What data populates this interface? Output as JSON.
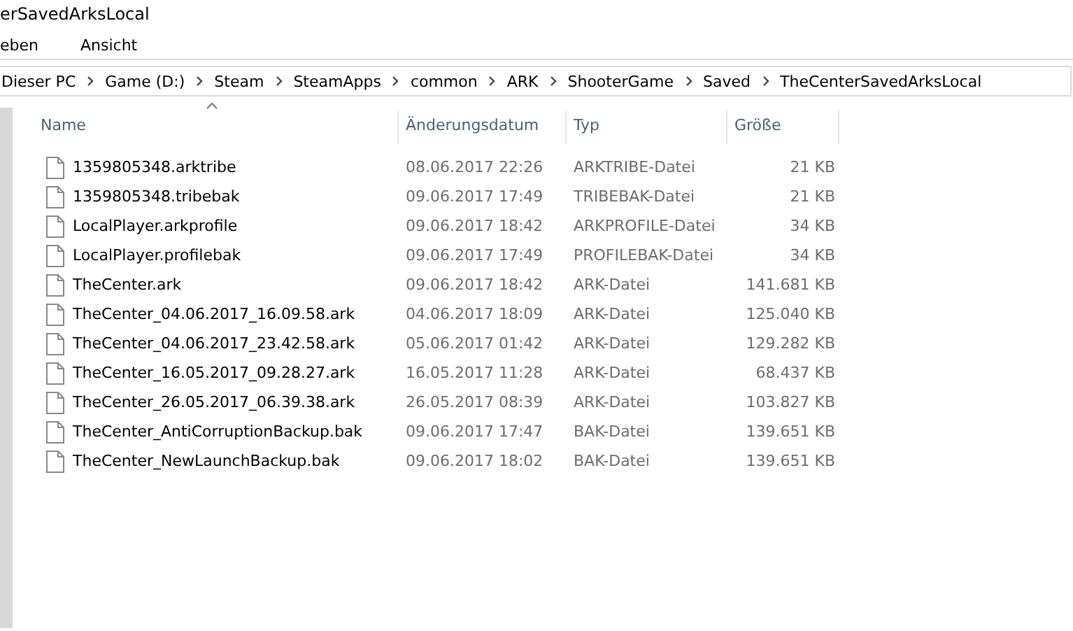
{
  "window": {
    "title": "erSavedArksLocal"
  },
  "menu": [
    "eben",
    "Ansicht"
  ],
  "breadcrumb": [
    "Dieser PC",
    "Game (D:)",
    "Steam",
    "SteamApps",
    "common",
    "ARK",
    "ShooterGame",
    "Saved",
    "TheCenterSavedArksLocal"
  ],
  "table": {
    "columns": [
      "Name",
      "Änderungsdatum",
      "Typ",
      "Größe"
    ],
    "rows": [
      {
        "name": "1359805348.arktribe",
        "date": "08.06.2017 22:26",
        "type": "ARKTRIBE-Datei",
        "size": "21 KB"
      },
      {
        "name": "1359805348.tribebak",
        "date": "09.06.2017 17:49",
        "type": "TRIBEBAK-Datei",
        "size": "21 KB"
      },
      {
        "name": "LocalPlayer.arkprofile",
        "date": "09.06.2017 18:42",
        "type": "ARKPROFILE-Datei",
        "size": "34 KB"
      },
      {
        "name": "LocalPlayer.profilebak",
        "date": "09.06.2017 17:49",
        "type": "PROFILEBAK-Datei",
        "size": "34 KB"
      },
      {
        "name": "TheCenter.ark",
        "date": "09.06.2017 18:42",
        "type": "ARK-Datei",
        "size": "141.681 KB"
      },
      {
        "name": "TheCenter_04.06.2017_16.09.58.ark",
        "date": "04.06.2017 18:09",
        "type": "ARK-Datei",
        "size": "125.040 KB"
      },
      {
        "name": "TheCenter_04.06.2017_23.42.58.ark",
        "date": "05.06.2017 01:42",
        "type": "ARK-Datei",
        "size": "129.282 KB"
      },
      {
        "name": "TheCenter_16.05.2017_09.28.27.ark",
        "date": "16.05.2017 11:28",
        "type": "ARK-Datei",
        "size": "68.437 KB"
      },
      {
        "name": "TheCenter_26.05.2017_06.39.38.ark",
        "date": "26.05.2017 08:39",
        "type": "ARK-Datei",
        "size": "103.827 KB"
      },
      {
        "name": "TheCenter_AntiCorruptionBackup.bak",
        "date": "09.06.2017 17:47",
        "type": "BAK-Datei",
        "size": "139.651 KB"
      },
      {
        "name": "TheCenter_NewLaunchBackup.bak",
        "date": "09.06.2017 18:02",
        "type": "BAK-Datei",
        "size": "139.651 KB"
      }
    ]
  }
}
